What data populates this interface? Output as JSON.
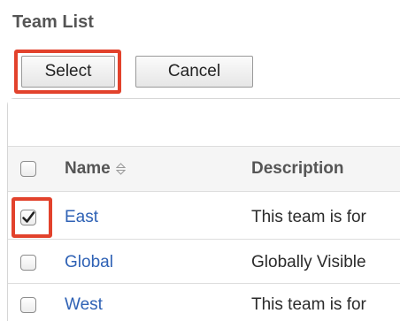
{
  "title": "Team List",
  "buttons": {
    "select_label": "Select",
    "cancel_label": "Cancel"
  },
  "table": {
    "columns": {
      "name": "Name",
      "description": "Description"
    },
    "rows": [
      {
        "name": "East",
        "description": "This team is for",
        "checked": true
      },
      {
        "name": "Global",
        "description": "Globally Visible",
        "checked": false
      },
      {
        "name": "West",
        "description": "This team is for",
        "checked": false
      }
    ]
  },
  "colors": {
    "highlight": "#e2422c",
    "link": "#2f62b5"
  },
  "icons": {
    "sort": "sort-icon",
    "checkmark": "checkmark-icon"
  }
}
